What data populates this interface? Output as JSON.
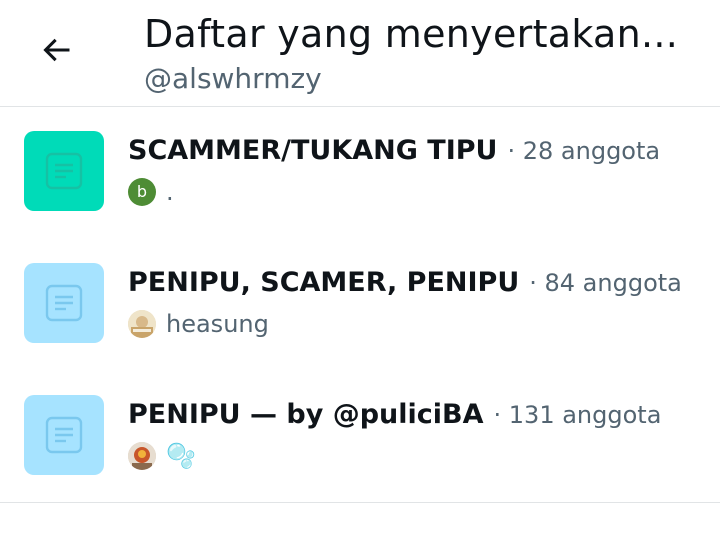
{
  "header": {
    "title": "Daftar yang menyertakan...",
    "subtitle": "@alswhrmzy"
  },
  "lists": [
    {
      "name": "SCAMMER/TUKANG TIPU",
      "count": "· 28 anggota",
      "owner_name": ".",
      "owner_avatar_letter": "b",
      "icon_color": "#00dbb8",
      "icon_color_name": "list-document-icon"
    },
    {
      "name": "PENIPU, SCAMER, PENIPU",
      "count": "· 84 anggota",
      "owner_name": "heasung",
      "icon_color": "#a6e3ff",
      "icon_color_name": "list-document-icon"
    },
    {
      "name": "PENIPU — by @puliciBA",
      "count": "· 131 anggota",
      "owner_name": "🫧",
      "icon_color": "#a6e3ff",
      "icon_color_name": "list-document-icon"
    }
  ],
  "colors": {
    "primary_text": "#0f1419",
    "secondary_text": "#536471",
    "divider": "#e1e4e6",
    "teal_icon": "#00dbb8",
    "light_blue_icon": "#a6e3ff",
    "green_avatar": "#4e8c35"
  }
}
